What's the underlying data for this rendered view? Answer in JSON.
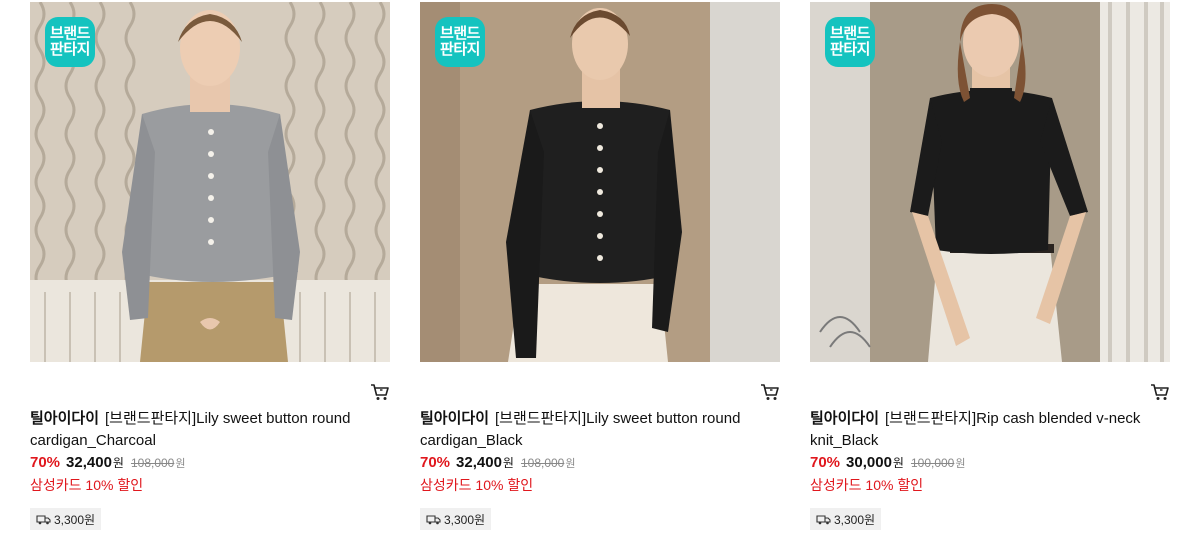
{
  "badge": {
    "line1": "브랜드",
    "line2": "판타지"
  },
  "products": [
    {
      "brand": "틸아이다이",
      "title": "[브랜드판타지]Lily sweet button round cardigan_Charcoal",
      "discount_rate": "70%",
      "price": "32,400",
      "price_unit": "원",
      "original_price": "108,000",
      "original_unit": "원",
      "card_discount": "삼성카드 10% 할인",
      "shipping_fee": "3,300원"
    },
    {
      "brand": "틸아이다이",
      "title": "[브랜드판타지]Lily sweet button round cardigan_Black",
      "discount_rate": "70%",
      "price": "32,400",
      "price_unit": "원",
      "original_price": "108,000",
      "original_unit": "원",
      "card_discount": "삼성카드 10% 할인",
      "shipping_fee": "3,300원"
    },
    {
      "brand": "틸아이다이",
      "title": "[브랜드판타지]Rip cash blended v-neck knit_Black",
      "discount_rate": "70%",
      "price": "30,000",
      "price_unit": "원",
      "original_price": "100,000",
      "original_unit": "원",
      "card_discount": "삼성카드 10% 할인",
      "shipping_fee": "3,300원"
    }
  ],
  "icons": {
    "cart": "cart-icon",
    "shipping": "truck-icon"
  },
  "colors": {
    "badge": "#14c3bf",
    "discount": "#e0171d",
    "shipping_bg": "#f0f0f0"
  }
}
